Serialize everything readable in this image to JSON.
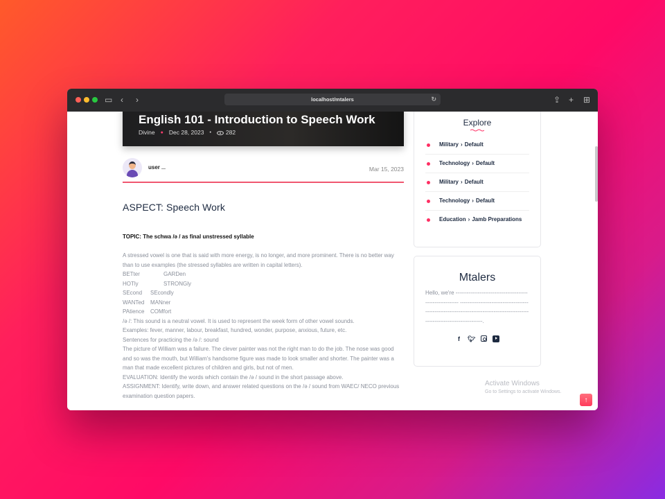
{
  "browser": {
    "url": "localhost/mtalers"
  },
  "hero": {
    "title": "English 101 - Introduction to Speech Work",
    "author": "Divine",
    "date": "Dec 28, 2023",
    "views": "282"
  },
  "post_author": {
    "name": "user",
    "date": "Mar 15, 2023"
  },
  "article": {
    "aspect": "ASPECT: Speech Work",
    "topic": "TOPIC: The schwa /ə / as final unstressed syllable",
    "intro": "A stressed vowel is one that is said with more energy, is no longer, and more prominent. There is no better way than to use examples (the stressed syllables are written in capital letters).",
    "pairs": [
      [
        "BETter",
        "GARDen"
      ],
      [
        "HOTly",
        "STRONGly"
      ],
      [
        "SEcond",
        "SEcondly"
      ],
      [
        "WANTed",
        "MANner"
      ],
      [
        "PAtience",
        "COMfort"
      ]
    ],
    "line1": "/ə /: This sound is a neutral vowel. It is used to represent the week form of other vowel sounds.",
    "line2": "Examples: fever, manner, labour, breakfast, hundred, wonder, purpose, anxious, future, etc.",
    "line3": "Sentences for practicing the /ə /: sound",
    "line4": "The picture of William was a failure. The clever painter was not the right man to do the job. The nose was good and so was the mouth, but William's handsome figure was made to look smaller and shorter. The painter was a man that made excellent pictures of children and girls, but not of men.",
    "line5": "EVALUATION: Identify the words which contain the /ə / sound in the short passage above.",
    "line6": "ASSIGNMENT: Identify, write down, and answer related questions on the /ə / sound from WAEC/ NECO previous examination question papers."
  },
  "explore": {
    "title": "Explore",
    "items": [
      {
        "cat": "Military",
        "sub": "Default"
      },
      {
        "cat": "Technology",
        "sub": "Default"
      },
      {
        "cat": "Military",
        "sub": "Default"
      },
      {
        "cat": "Technology",
        "sub": "Default"
      },
      {
        "cat": "Education",
        "sub": "Jamb Preparations"
      }
    ]
  },
  "about": {
    "title": "Mtalers",
    "text": "Hello, we're --------------------------------------------------------- ----------------------------------------------------------------------------------------------------------------------------."
  },
  "watermark": {
    "line1": "Activate Windows",
    "line2": "Go to Settings to activate Windows."
  },
  "colors": {
    "accent": "#ff2e63",
    "heading": "#1d2a40"
  }
}
